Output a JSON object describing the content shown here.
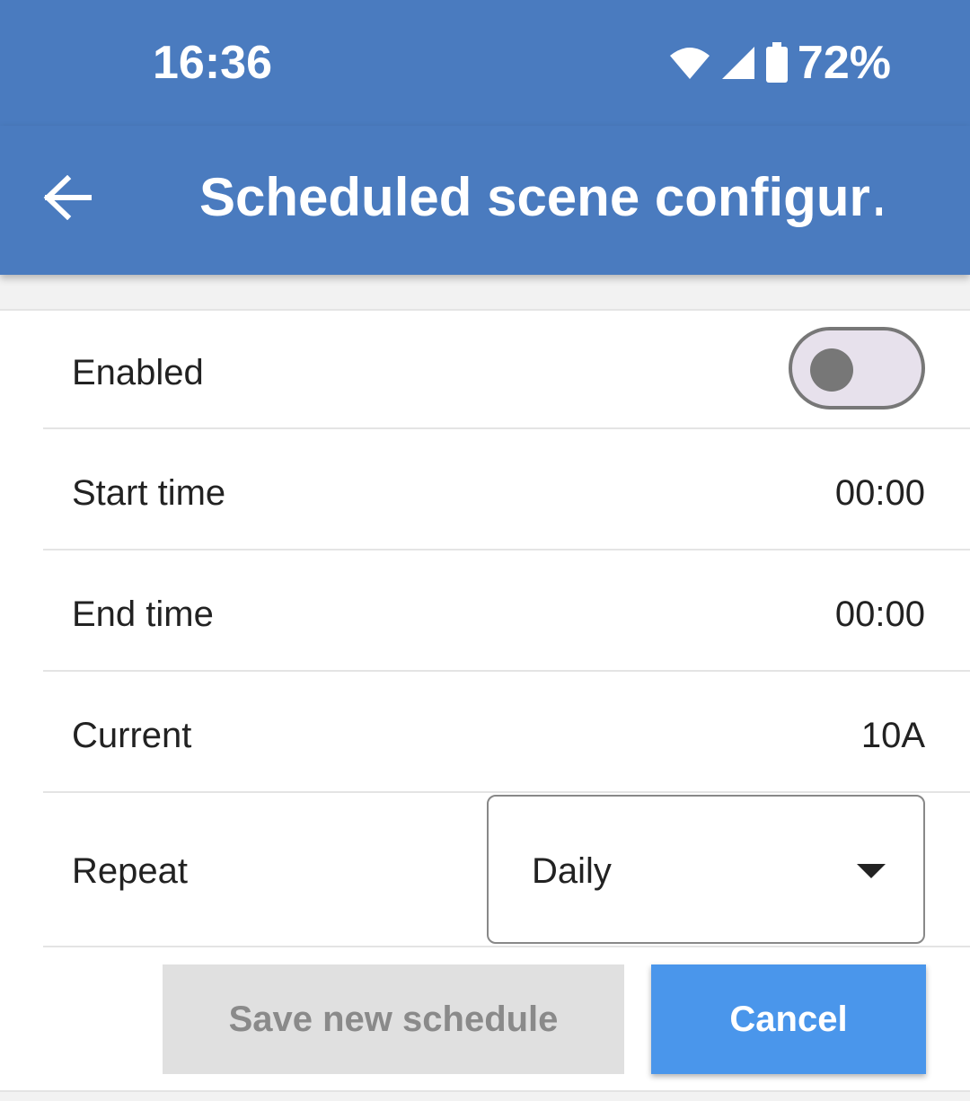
{
  "status_bar": {
    "time": "16:36",
    "battery_percent": "72%",
    "icons": [
      "wifi-icon",
      "cellular-signal-icon",
      "battery-icon"
    ]
  },
  "app_bar": {
    "title": "Scheduled scene configur…",
    "back_icon": "arrow-left-icon",
    "color": "#4a7bbf"
  },
  "form": {
    "enabled": {
      "label": "Enabled",
      "value": false
    },
    "start_time": {
      "label": "Start time",
      "value": "00:00"
    },
    "end_time": {
      "label": "End time",
      "value": "00:00"
    },
    "current": {
      "label": "Current",
      "value": "10A"
    },
    "repeat": {
      "label": "Repeat",
      "selected": "Daily"
    }
  },
  "actions": {
    "save_label": "Save new schedule",
    "cancel_label": "Cancel",
    "cancel_color": "#4a96eb"
  }
}
